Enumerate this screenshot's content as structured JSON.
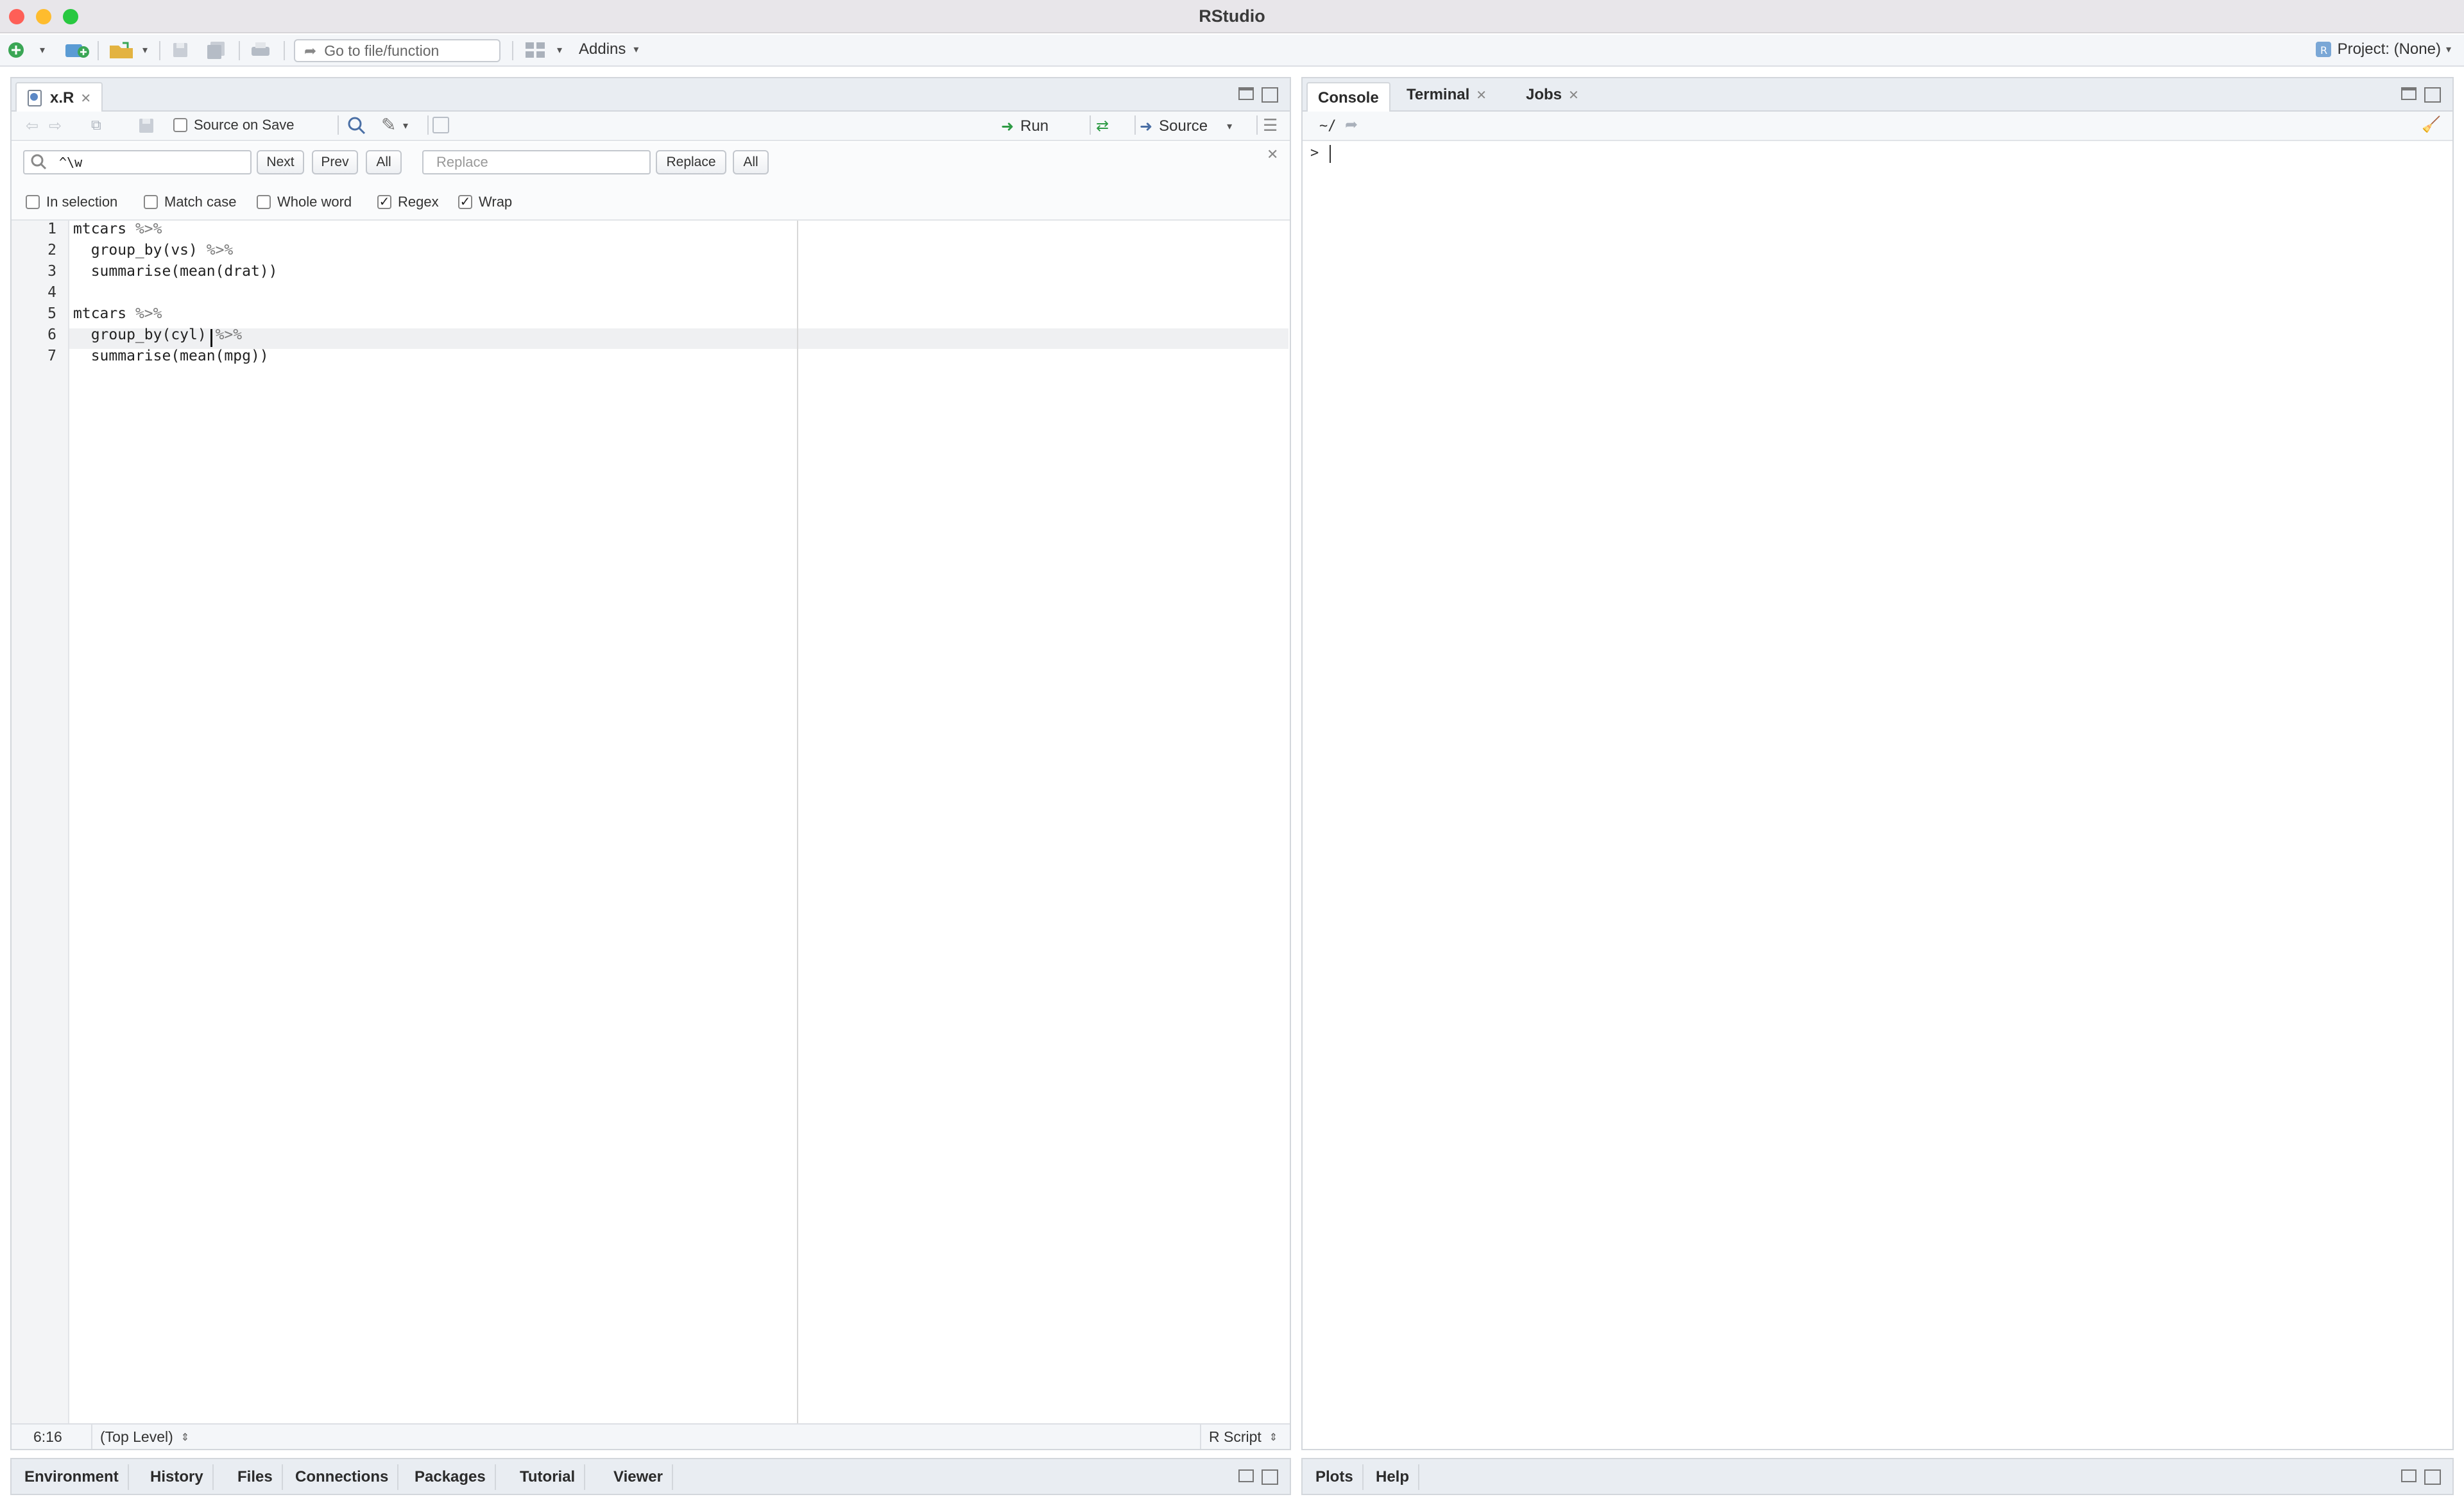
{
  "window": {
    "title": "RStudio"
  },
  "toolbar": {
    "goto_placeholder": "Go to file/function",
    "addins_label": "Addins",
    "project_label": "Project: (None)"
  },
  "editor": {
    "tab_name": "x.R",
    "source_on_save_label": "Source on Save",
    "run_label": "Run",
    "source_label": "Source",
    "find": {
      "search_value": "^\\w",
      "next_label": "Next",
      "prev_label": "Prev",
      "all_label": "All",
      "replace_placeholder": "Replace",
      "replace_label": "Replace",
      "replace_all_label": "All"
    },
    "options": [
      {
        "label": "In selection",
        "checked": false
      },
      {
        "label": "Match case",
        "checked": false
      },
      {
        "label": "Whole word",
        "checked": false
      },
      {
        "label": "Regex",
        "checked": true
      },
      {
        "label": "Wrap",
        "checked": true
      }
    ],
    "line_numbers": [
      "1",
      "2",
      "3",
      "4",
      "5",
      "6",
      "7"
    ],
    "code": [
      {
        "text": "mtcars",
        "op": "%>%"
      },
      {
        "text": "  group_by(vs)",
        "op": "%>%"
      },
      {
        "text": "  summarise(mean(drat))",
        "op": ""
      },
      {
        "text": "",
        "op": ""
      },
      {
        "text": "mtcars",
        "op": "%>%"
      },
      {
        "text": "  group_by(cyl)",
        "op": "%>%"
      },
      {
        "text": "  summarise(mean(mpg))",
        "op": ""
      }
    ],
    "status": {
      "position": "6:16",
      "scope": "(Top Level)",
      "file_type": "R Script"
    }
  },
  "console": {
    "tabs": [
      "Console",
      "Terminal",
      "Jobs"
    ],
    "path": "~/",
    "prompt": ">"
  },
  "bottom_left_tabs": [
    "Environment",
    "History",
    "Files",
    "Connections",
    "Packages",
    "Tutorial",
    "Viewer"
  ],
  "bottom_right_tabs": [
    "Plots",
    "Help"
  ],
  "colors": {
    "run_arrow": "#2e9b45",
    "close_red": "#fe5f57",
    "minimize_yellow": "#febc2e",
    "zoom_green": "#28c840"
  }
}
